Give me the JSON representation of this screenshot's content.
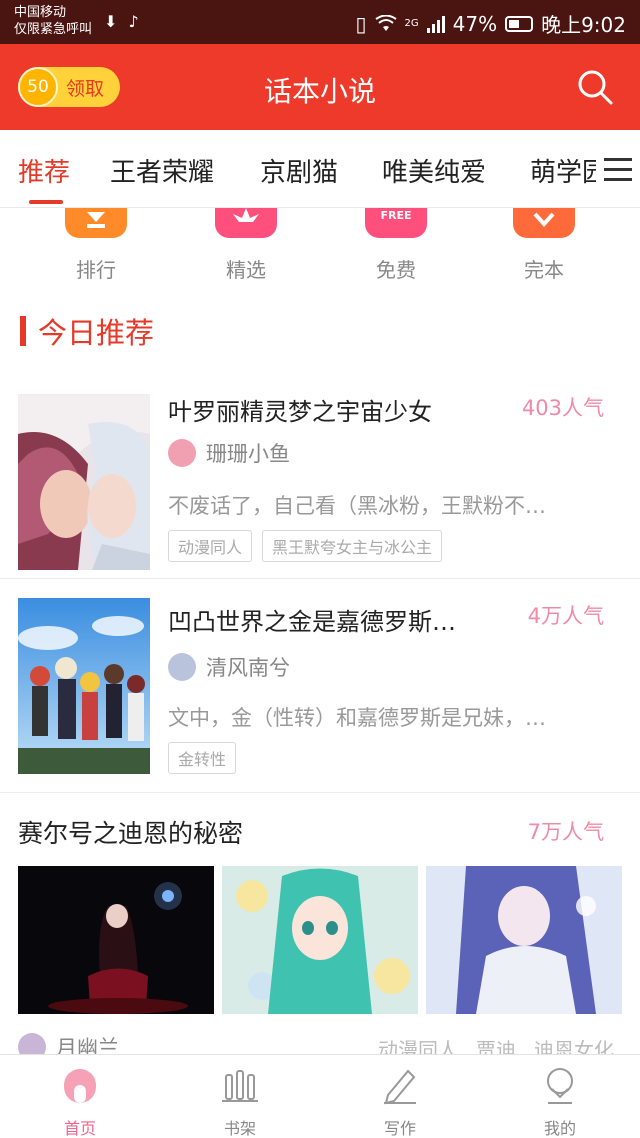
{
  "status_bar": {
    "carrier": "中国移动",
    "emergency": "仅限紧急呼叫",
    "network_type": "2G",
    "battery": "47%",
    "time": "晚上9:02"
  },
  "header": {
    "coins": "50",
    "claim_label": "领取",
    "title": "话本小说"
  },
  "tabs": [
    {
      "label": "推荐"
    },
    {
      "label": "王者荣耀"
    },
    {
      "label": "京剧猫"
    },
    {
      "label": "唯美纯爱"
    },
    {
      "label": "萌学园"
    }
  ],
  "quick_entries": [
    {
      "label": "排行",
      "color": "#ff8a2a"
    },
    {
      "label": "精选",
      "color": "#ff4f7d"
    },
    {
      "label": "免费",
      "color": "#ff4f7d",
      "badge": "FREE"
    },
    {
      "label": "完本",
      "color": "#ff6a3a"
    }
  ],
  "section_title": "今日推荐",
  "books": [
    {
      "title": "叶罗丽精灵梦之宇宙少女",
      "popularity": "403人气",
      "author": "珊珊小鱼",
      "description": "不废话了，自己看（黑冰粉，王默粉不…",
      "tags": [
        "动漫同人",
        "黑王默夸女主与冰公主"
      ]
    },
    {
      "title": "凹凸世界之金是嘉德罗斯…",
      "popularity": "4万人气",
      "author": "清风南兮",
      "description": "文中，金（性转）和嘉德罗斯是兄妹，…",
      "tags": [
        "金转性"
      ]
    }
  ],
  "featured": {
    "title": "赛尔号之迪恩的秘密",
    "popularity": "7万人气",
    "author": "月幽兰",
    "tags": [
      "动漫同人",
      "贾迪",
      "迪恩女化"
    ]
  },
  "bottom_nav": [
    {
      "label": "首页",
      "active": true
    },
    {
      "label": "书架",
      "active": false
    },
    {
      "label": "写作",
      "active": false
    },
    {
      "label": "我的",
      "active": false
    }
  ],
  "colors": {
    "brand_red": "#ed3a2a",
    "popularity_pink": "#f08aa6",
    "nav_active": "#f0658a"
  }
}
